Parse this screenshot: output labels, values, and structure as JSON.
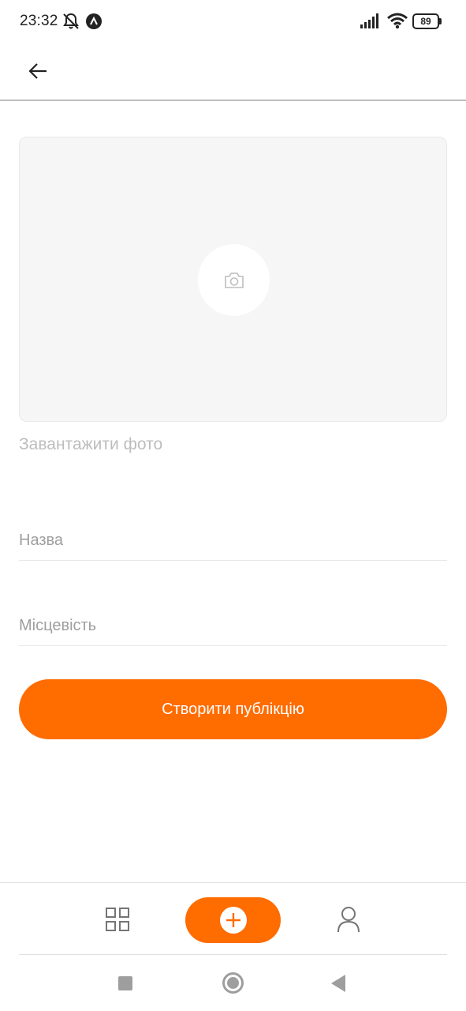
{
  "status_bar": {
    "time": "23:32",
    "battery_level": "89",
    "icons": [
      "bell-off-icon",
      "app-notification-icon",
      "signal-icon",
      "wifi-icon",
      "battery-icon"
    ]
  },
  "header": {
    "back_icon": "arrow-left-icon"
  },
  "photo": {
    "camera_icon": "camera-icon",
    "upload_label": "Завантажити фото"
  },
  "form": {
    "title_placeholder": "Назва",
    "title_value": "",
    "location_placeholder": "Місцевість",
    "location_value": ""
  },
  "submit": {
    "label": "Створити публікцію"
  },
  "tab_bar": {
    "items": [
      {
        "icon": "grid-icon",
        "active": false
      },
      {
        "icon": "plus-icon",
        "active": true
      },
      {
        "icon": "user-icon",
        "active": false
      }
    ]
  },
  "colors": {
    "accent": "#FF6C00",
    "placeholder": "#BDBDBD",
    "photo_bg": "#F6F6F6",
    "border": "#E8E8E8"
  }
}
